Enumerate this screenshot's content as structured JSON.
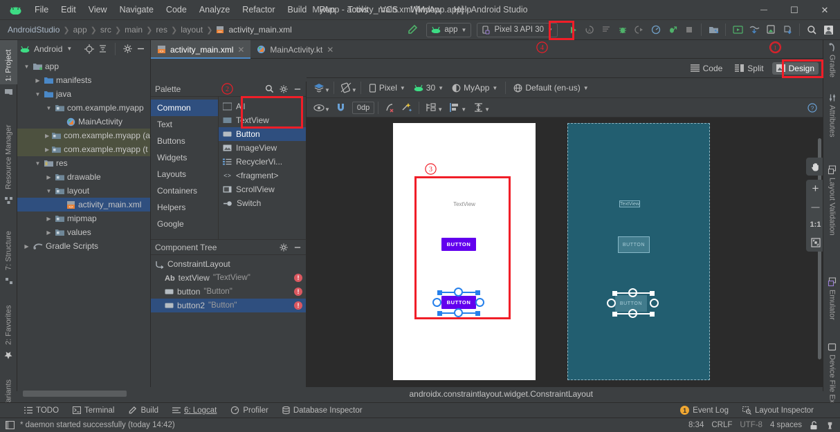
{
  "window": {
    "title": "MyApp - activity_main.xml [MyApp.app] - Android Studio",
    "minimize": "—",
    "maximize": "☐",
    "close": "✕"
  },
  "menubar": {
    "items": [
      "File",
      "Edit",
      "View",
      "Navigate",
      "Code",
      "Analyze",
      "Refactor",
      "Build",
      "Run",
      "Tools",
      "VCS",
      "Window",
      "Help"
    ]
  },
  "breadcrumbs": [
    "AndroidStudio",
    "app",
    "src",
    "main",
    "res",
    "layout",
    "activity_main.xml"
  ],
  "toolbar": {
    "module_selector": "app",
    "device_selector": "Pixel 3 API 30",
    "run_label": "Run",
    "stop_label": "Stop"
  },
  "left_tool_strip": [
    "1: Project",
    "Resource Manager",
    "7: Structure",
    "2: Favorites",
    "Build Variants"
  ],
  "right_tool_strip": [
    "Gradle",
    "Attributes",
    "Layout Validation",
    "Emulator",
    "Device File Explorer"
  ],
  "project": {
    "title": "Android",
    "tree": [
      {
        "label": "app",
        "depth": 0,
        "arrow": "▼",
        "icon": "module-icon",
        "state": "normal"
      },
      {
        "label": "manifests",
        "depth": 1,
        "arrow": "▶",
        "icon": "folder-icon",
        "state": "normal"
      },
      {
        "label": "java",
        "depth": 1,
        "arrow": "▼",
        "icon": "folder-icon",
        "state": "normal"
      },
      {
        "label": "com.example.myapp",
        "depth": 2,
        "arrow": "▼",
        "icon": "package-icon",
        "state": "normal"
      },
      {
        "label": "MainActivity",
        "depth": 3,
        "arrow": "",
        "icon": "kotlin-class-icon",
        "state": "normal"
      },
      {
        "label": "com.example.myapp (a",
        "depth": 2,
        "arrow": "▶",
        "icon": "package-icon",
        "state": "highlight"
      },
      {
        "label": "com.example.myapp (t",
        "depth": 2,
        "arrow": "▶",
        "icon": "package-icon",
        "state": "highlight"
      },
      {
        "label": "res",
        "depth": 1,
        "arrow": "▼",
        "icon": "res-folder-icon",
        "state": "normal"
      },
      {
        "label": "drawable",
        "depth": 2,
        "arrow": "▶",
        "icon": "package-icon",
        "state": "normal"
      },
      {
        "label": "layout",
        "depth": 2,
        "arrow": "▼",
        "icon": "package-icon",
        "state": "normal"
      },
      {
        "label": "activity_main.xml",
        "depth": 3,
        "arrow": "",
        "icon": "layout-xml-icon",
        "state": "selected"
      },
      {
        "label": "mipmap",
        "depth": 2,
        "arrow": "▶",
        "icon": "package-icon",
        "state": "normal"
      },
      {
        "label": "values",
        "depth": 2,
        "arrow": "▶",
        "icon": "package-icon",
        "state": "normal"
      },
      {
        "label": "Gradle Scripts",
        "depth": 0,
        "arrow": "▶",
        "icon": "gradle-icon",
        "state": "normal"
      }
    ]
  },
  "editor_tabs": [
    {
      "label": "activity_main.xml",
      "icon": "layout-xml-icon",
      "active": true
    },
    {
      "label": "MainActivity.kt",
      "icon": "kotlin-class-icon",
      "active": false
    }
  ],
  "editor_modes": [
    {
      "label": "Code",
      "selected": false
    },
    {
      "label": "Split",
      "selected": false
    },
    {
      "label": "Design",
      "selected": true
    }
  ],
  "palette": {
    "title": "Palette",
    "categories": [
      {
        "label": "Common",
        "selected": true
      },
      {
        "label": "Text",
        "selected": false
      },
      {
        "label": "Buttons",
        "selected": false
      },
      {
        "label": "Widgets",
        "selected": false
      },
      {
        "label": "Layouts",
        "selected": false
      },
      {
        "label": "Containers",
        "selected": false
      },
      {
        "label": "Helpers",
        "selected": false
      },
      {
        "label": "Google",
        "selected": false
      }
    ],
    "items": [
      {
        "label": "All",
        "icon": "all-icon",
        "selected": false
      },
      {
        "label": "TextView",
        "icon": "textview-icon",
        "selected": false
      },
      {
        "label": "Button",
        "icon": "button-icon",
        "selected": true
      },
      {
        "label": "ImageView",
        "icon": "imageview-icon",
        "selected": false
      },
      {
        "label": "RecyclerVi...",
        "icon": "recyclerview-icon",
        "selected": false
      },
      {
        "label": "<fragment>",
        "icon": "fragment-icon",
        "selected": false
      },
      {
        "label": "ScrollView",
        "icon": "scrollview-icon",
        "selected": false
      },
      {
        "label": "Switch",
        "icon": "switch-icon",
        "selected": false
      }
    ]
  },
  "component_tree": {
    "title": "Component Tree",
    "rows": [
      {
        "name": "ConstraintLayout",
        "value": "",
        "depth": 0,
        "icon": "constraintlayout-icon",
        "error": false,
        "selected": false
      },
      {
        "name": "textView",
        "value": "\"TextView\"",
        "depth": 1,
        "icon": "textview-ab-icon",
        "error": true,
        "selected": false
      },
      {
        "name": "button",
        "value": "\"Button\"",
        "depth": 1,
        "icon": "button-icon",
        "error": true,
        "selected": false
      },
      {
        "name": "button2",
        "value": "\"Button\"",
        "depth": 1,
        "icon": "button-icon",
        "error": true,
        "selected": true
      }
    ],
    "error_glyph": "!"
  },
  "design_toolbar": {
    "device": "Pixel",
    "api": "30",
    "theme": "MyApp",
    "locale": "Default (en-us)",
    "margin": "0dp",
    "help_glyph": "?"
  },
  "preview": {
    "design_device": {
      "textview_label": "TextView",
      "button_label": "BUTTON",
      "button2_label": "BUTTON"
    },
    "blueprint_device": {
      "textview_label": "TextView",
      "button_label": "BUTTON",
      "button2_label": "BUTTON"
    }
  },
  "zoom_controls": {
    "pan": "pan-hand-icon",
    "zoom_in": "+",
    "zoom_out": "—",
    "actual_size": "1:1",
    "fit_screen": "fit-screen-icon"
  },
  "status_line": {
    "selected_component": "androidx.constraintlayout.widget.ConstraintLayout"
  },
  "bottom_tabs": [
    {
      "label": "TODO",
      "icon": "todo-icon"
    },
    {
      "label": "Terminal",
      "icon": "terminal-icon"
    },
    {
      "label": "Build",
      "icon": "build-hammer-icon"
    },
    {
      "label": "6: Logcat",
      "icon": "logcat-icon"
    },
    {
      "label": "Profiler",
      "icon": "profiler-icon"
    },
    {
      "label": "Database Inspector",
      "icon": "database-icon"
    }
  ],
  "bottom_right_tabs": [
    {
      "label": "Event Log",
      "icon": "event-log-icon",
      "badge": "1"
    },
    {
      "label": "Layout Inspector",
      "icon": "layout-inspector-icon",
      "badge": ""
    }
  ],
  "statusbar": {
    "message": "* daemon started successfully (today 14:42)",
    "caret": "8:34",
    "line_sep": "CRLF",
    "encoding": "UTF-8",
    "indent": "4 spaces",
    "lock": "unlock-icon",
    "inspection": "inspection-icon"
  },
  "annotations": [
    {
      "number": "①",
      "target": "design-mode-button"
    },
    {
      "number": "②",
      "target": "palette-button-item"
    },
    {
      "number": "③",
      "target": "preview-layout-region"
    },
    {
      "number": "④",
      "target": "run-button"
    }
  ],
  "colors": {
    "accent_red": "#f01e28",
    "selection_blue": "#2f4f7f",
    "handle_blue": "#2680eb",
    "button_purple": "#6200ee",
    "blueprint_bg": "#225e70",
    "panel_bg": "#3c3f41",
    "canvas_bg": "#2b2b2b",
    "badge_orange": "#f0a732"
  }
}
